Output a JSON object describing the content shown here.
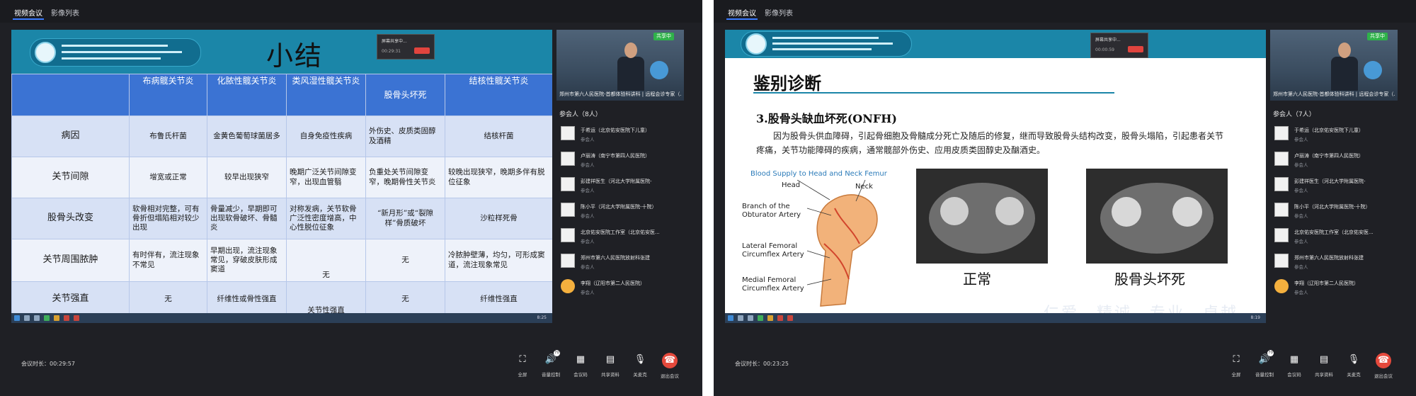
{
  "tabs": [
    "视频会议",
    "影像列表"
  ],
  "left": {
    "slide": {
      "title": "小结",
      "popup_text": "屏幕共享中...",
      "popup_time": "00:29:31",
      "table": {
        "headers": [
          "",
          "布病髋关节炎",
          "化脓性髋关节炎",
          "类风湿性髋关节炎",
          "股骨头坏死",
          "结核性髋关节炎"
        ],
        "rows": [
          {
            "label": "病因",
            "cells": [
              "布鲁氏杆菌",
              "金黄色葡萄球菌居多",
              "自身免疫性疾病",
              "外伤史、皮质类固醇及酒精",
              "结核杆菌"
            ]
          },
          {
            "label": "关节间隙",
            "cells": [
              "增宽或正常",
              "较早出现狭窄",
              "晚期广泛关节间隙变窄，出现血管翳",
              "负重处关节间隙变窄，晚期骨性关节炎",
              "较晚出现狭窄，晚期多伴有脱位征象"
            ]
          },
          {
            "label": "股骨头改变",
            "cells": [
              "软骨相对完整，可有骨折但塌陷相对较少出现",
              "骨量减少，早期即可出现软骨破坏、骨髓炎",
              "对称发病，关节软骨广泛性密度增高，中心性脱位征象",
              "“新月形”或“裂隙样”骨质破坏",
              "沙粒样死骨"
            ]
          },
          {
            "label": "关节周围脓肿",
            "cells": [
              "有时伴有，流注现象不常见",
              "早期出现，流注现象常见，穿破皮肤形成窦道",
              "无",
              "无",
              "冷脓肿壁薄，均匀，可形成窦道，流注现象常见"
            ]
          },
          {
            "label": "关节强直",
            "cells": [
              "无",
              "纤维性或骨性强直",
              "关节性强直",
              "无",
              "纤维性强直"
            ]
          }
        ]
      },
      "taskbar_time": "8:25"
    },
    "camera": {
      "badge": "共享中",
      "caption": "郑州市第六人民医院-首都体验科讲科 | 远程会诊专家（..."
    },
    "participants_title": "参会人（8人）",
    "participants": [
      {
        "name": "于希运（北京佑安医院下儿童）",
        "role": "参会人",
        "emoji": false
      },
      {
        "name": "卢丽涛（南宁市第四人民医院）",
        "role": "参会人",
        "emoji": false
      },
      {
        "name": "彭建祥医生（河北大学附属医院-",
        "role": "参会人",
        "emoji": false
      },
      {
        "name": "陈小平（河北大学附属医院-十院）",
        "role": "参会人",
        "emoji": false
      },
      {
        "name": "北京佑安医院工作室（北京佑安医...",
        "role": "参会人",
        "emoji": false
      },
      {
        "name": "郑州市第六人民医院放射科张建",
        "role": "参会人",
        "emoji": false
      },
      {
        "name": "李翔（辽阳市第二人民医院）",
        "role": "参会人",
        "emoji": true
      }
    ],
    "meeting_time": "会议时长：00:29:57",
    "controls": [
      "全屏",
      "音量控制",
      "会议码",
      "共享资料",
      "关麦克",
      "退出会议"
    ],
    "volume_badge": "70"
  },
  "right": {
    "slide": {
      "title": "鉴别诊断",
      "subtitle": "3.股骨头缺血坏死(ONFH)",
      "paragraph": "因为股骨头供血障碍，引起骨细胞及骨髓成分死亡及随后的修复，继而导致股骨头结构改变，股骨头塌陷，引起患者关节疼痛，关节功能障碍的疾病，通常髋部外伤史、应用皮质类固醇史及酗酒史。",
      "figure_title": "Blood Supply to Head and Neck Femur",
      "labels": [
        "Head",
        "Neck",
        "Branch of the Obturator Artery",
        "Lateral Femoral Circumflex Artery",
        "Medial Femoral Circumflex Artery"
      ],
      "caption_normal": "正常",
      "caption_disease": "股骨头坏死",
      "watermark": [
        "仁爱",
        "精诚",
        "专业",
        "卓越"
      ],
      "popup_text": "屏幕共享中...",
      "popup_time": "00:00:59",
      "taskbar_time": "8:19"
    },
    "camera": {
      "badge": "共享中",
      "caption": "郑州市第六人民医院-首都体验科讲科 | 远程会诊专家（..."
    },
    "participants_title": "参会人（7人）",
    "participants": [
      {
        "name": "于希运（北京佑安医院下儿童）",
        "role": "参会人",
        "emoji": false
      },
      {
        "name": "卢丽涛（南宁市第四人民医院）",
        "role": "参会人",
        "emoji": false
      },
      {
        "name": "彭建祥医生（河北大学附属医院-",
        "role": "参会人",
        "emoji": false
      },
      {
        "name": "陈小平（河北大学附属医院-十院）",
        "role": "参会人",
        "emoji": false
      },
      {
        "name": "北京佑安医院工作室（北京佑安医...",
        "role": "参会人",
        "emoji": false
      },
      {
        "name": "郑州市第六人民医院放射科张建",
        "role": "参会人",
        "emoji": false
      },
      {
        "name": "李翔（辽阳市第二人民医院）",
        "role": "参会人",
        "emoji": true
      }
    ],
    "meeting_time": "会议时长：00:23:25",
    "controls": [
      "全屏",
      "音量控制",
      "会议码",
      "共享资料",
      "关麦克",
      "退出会议"
    ],
    "volume_badge": "70"
  },
  "icons": {
    "fullscreen": "fullscreen-icon",
    "volume": "speaker-icon",
    "qrcode": "qrcode-icon",
    "share": "document-icon",
    "mic": "microphone-icon",
    "hangup": "phone-hangup-icon"
  },
  "colors": {
    "window_bg": "#1f2025",
    "slide_header": "#1b86a8",
    "table_header": "#3b73d3",
    "hangup": "#e5493c",
    "badge_green": "#2fb24a"
  }
}
